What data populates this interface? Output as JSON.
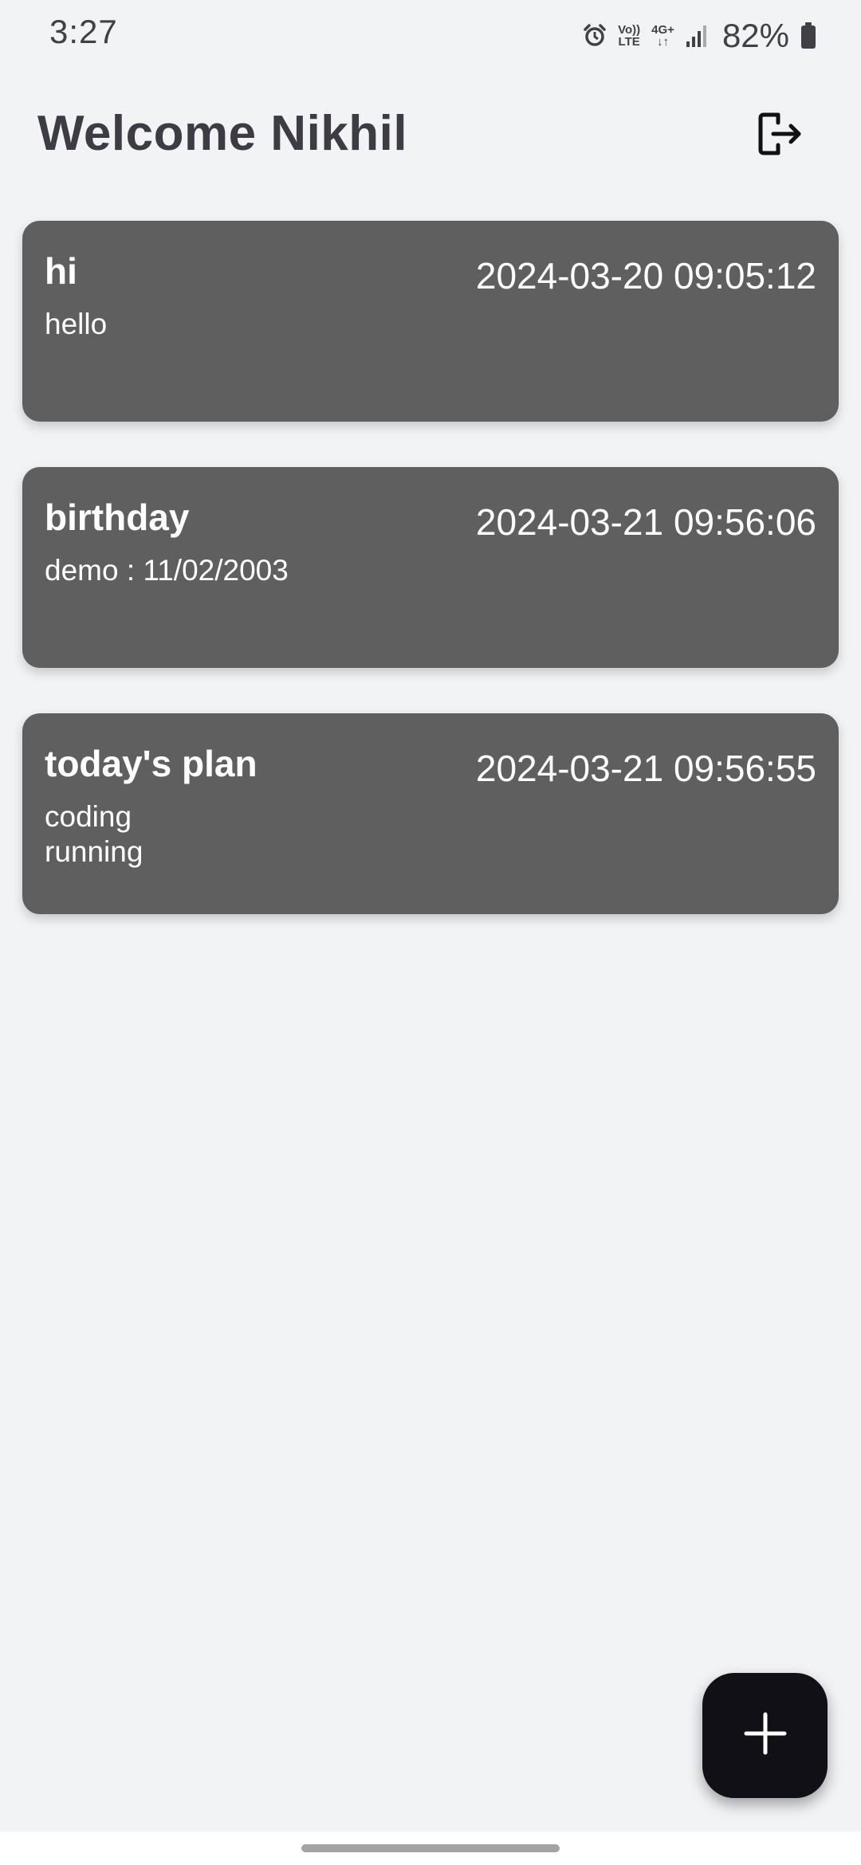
{
  "status_bar": {
    "time": "3:27",
    "icons": [
      "alarm-icon",
      "volte-icon",
      "4g-plus-icon",
      "signal-icon",
      "battery-icon"
    ],
    "volte_top": "Vo))",
    "volte_bottom": "LTE",
    "network_label": "4G+",
    "battery_percent": "82%"
  },
  "header": {
    "title": "Welcome Nikhil",
    "logout_icon": "logout-icon"
  },
  "notes": [
    {
      "title": "hi",
      "date": "2024-03-20 09:05:12",
      "body": "hello"
    },
    {
      "title": "birthday",
      "date": "2024-03-21 09:56:06",
      "body": "demo : 11/02/2003"
    },
    {
      "title": "today's plan",
      "date": "2024-03-21 09:56:55",
      "body": "coding\nrunning"
    }
  ],
  "fab": {
    "icon": "plus-icon"
  },
  "colors": {
    "background": "#f2f3f5",
    "card": "#5f5f5f",
    "fab": "#111016",
    "title": "#3d3c44"
  }
}
